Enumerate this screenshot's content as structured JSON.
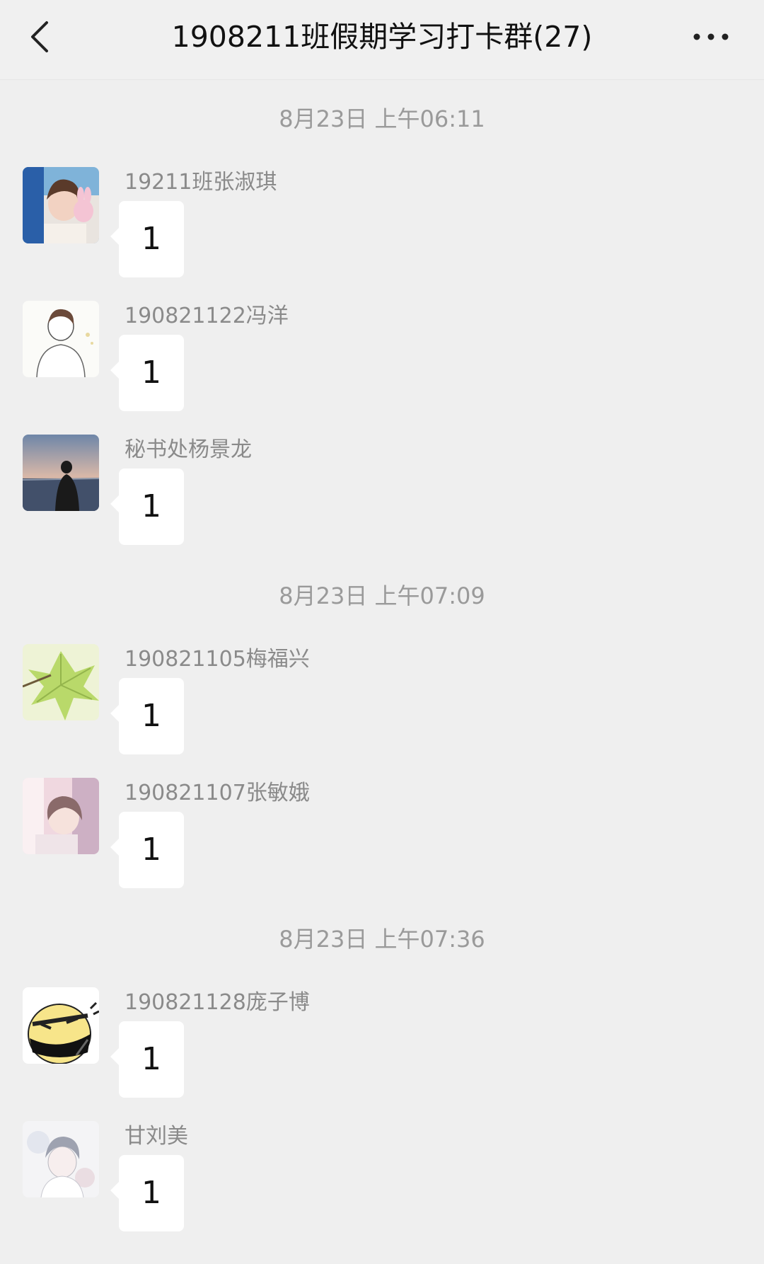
{
  "header": {
    "title": "1908211班假期学习打卡群(27)",
    "back_icon": "chevron-left-icon",
    "more_icon": "more-dots-icon"
  },
  "timestamps": [
    "8月23日 上午06:11",
    "8月23日 上午07:09",
    "8月23日 上午07:36"
  ],
  "messages": [
    {
      "sender": "19211班张淑琪",
      "text": "1"
    },
    {
      "sender": "190821122冯洋",
      "text": "1"
    },
    {
      "sender": "秘书处杨景龙",
      "text": "1"
    },
    {
      "sender": "190821105梅福兴",
      "text": "1"
    },
    {
      "sender": "190821107张敏娥",
      "text": "1"
    },
    {
      "sender": "190821128庞子博",
      "text": "1"
    },
    {
      "sender": "甘刘美",
      "text": "1"
    }
  ],
  "colors": {
    "background": "#efefef",
    "bubble": "#ffffff",
    "meta_text": "#9a9a9a"
  }
}
